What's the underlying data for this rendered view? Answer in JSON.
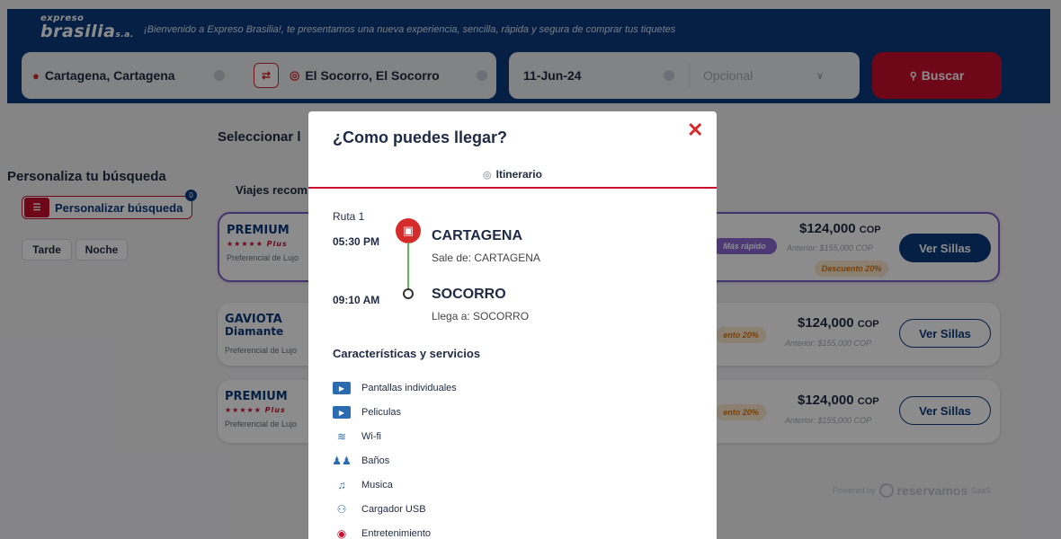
{
  "header": {
    "logo_top": "expreso",
    "logo_main": "brasilia",
    "logo_suffix": "s.a.",
    "welcome": "¡Bienvenido a Expreso Brasilia!, te presentamos una nueva experiencia, sencilla, rápida y segura de comprar tus tiquetes"
  },
  "search": {
    "origin": "Cartagena, Cartagena",
    "destination": "El Socorro, El Socorro",
    "date": "11-Jun-24",
    "return_placeholder": "Opcional",
    "search_button": "Buscar",
    "swap_icon": "swap-icon"
  },
  "left": {
    "title": "Personaliza tu búsqueda",
    "customize_button": "Personalizar búsqueda",
    "customize_count": "0",
    "chips": [
      "Tarde",
      "Noche"
    ]
  },
  "main": {
    "select_title": "Seleccionar l",
    "recommended": "Viajes recom"
  },
  "cards": [
    {
      "brand": "PREMIUM",
      "brand_line2": "★★★★★ Plus",
      "sub": "Preferencial de Lujo",
      "tag": "Más rápido",
      "price": "$124,000",
      "currency": "COP",
      "previous": "Anterior: $155,000 COP",
      "discount": "Descuento 20%",
      "button": "Ver Sillas"
    },
    {
      "brand": "GAVIOTA",
      "brand_line2": "Diamante",
      "sub": "Preferencial de Lujo",
      "tag": "ento 20%",
      "price": "$124,000",
      "currency": "COP",
      "previous": "Anterior: $155,000 COP",
      "button": "Ver Sillas"
    },
    {
      "brand": "PREMIUM",
      "brand_line2": "★★★★★ Plus",
      "sub": "Preferencial de Lujo",
      "tag": "ento 20%",
      "price": "$124,000",
      "currency": "COP",
      "previous": "Anterior: $155,000 COP",
      "button": "Ver Sillas"
    }
  ],
  "footer": {
    "powered": "Powered by",
    "brand": "reservamos",
    "suffix": "SaaS"
  },
  "modal": {
    "title": "¿Como puedes llegar?",
    "tab": "Itinerario",
    "route": "Ruta 1",
    "departure_time": "05:30 PM",
    "departure_city": "CARTAGENA",
    "departure_sub": "Sale de: CARTAGENA",
    "arrival_time": "09:10 AM",
    "arrival_city": "SOCORRO",
    "arrival_sub": "Llega a: SOCORRO",
    "features_title": "Características y servicios",
    "features": [
      {
        "label": "Pantallas individuales",
        "icon": "screen-icon"
      },
      {
        "label": "Peliculas",
        "icon": "film-icon"
      },
      {
        "label": "Wi-fi",
        "icon": "wifi-icon"
      },
      {
        "label": "Baños",
        "icon": "restroom-icon"
      },
      {
        "label": "Musica",
        "icon": "music-icon"
      },
      {
        "label": "Cargador USB",
        "icon": "usb-icon"
      },
      {
        "label": "Entretenimiento",
        "icon": "entertainment-icon"
      }
    ]
  },
  "colors": {
    "brand_blue": "#0b3a7e",
    "accent_red": "#c8102e",
    "route_green": "#5cb85c",
    "premium_purple": "#7b5cc7"
  }
}
